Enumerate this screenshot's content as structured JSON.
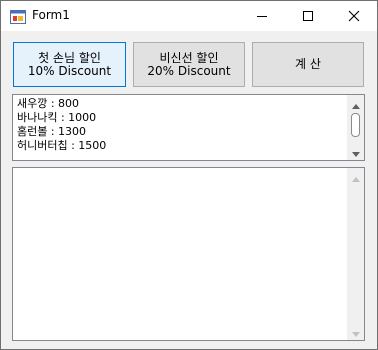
{
  "window": {
    "title": "Form1"
  },
  "buttons": {
    "first_discount": {
      "line1": "첫 손님 할인",
      "line2": "10% Discount"
    },
    "offpeak_discount": {
      "line1": "비신선 할인",
      "line2": "20% Discount"
    },
    "calculate": {
      "label": "계 산"
    }
  },
  "menu_list": {
    "items": [
      "새우깡 : 800",
      "바나나킥 : 1000",
      "홈런볼 : 1300",
      "허니버터칩 : 1500"
    ]
  },
  "output_text": {
    "value": ""
  },
  "icons": {
    "app": "form-app-icon",
    "minimize": "minimize-icon",
    "maximize": "maximize-icon",
    "close": "close-icon"
  },
  "colors": {
    "accent": "#0078d7",
    "window_bg": "#f0f0f0"
  }
}
